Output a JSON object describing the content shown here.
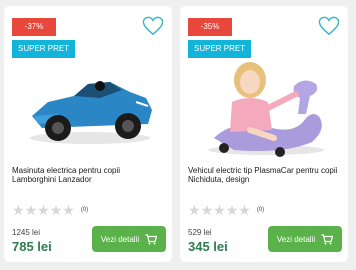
{
  "products": [
    {
      "discount": "-37%",
      "badge": "SUPER PRET",
      "title": "Masinuta electrica pentru copii Lamborghini Lanzador",
      "rating_count": "(0)",
      "old_price": "1245 lei",
      "price": "785 lei",
      "button": "Vezi detalii",
      "image": "blue-electric-car",
      "icons": [
        "heart-icon",
        "star-icon",
        "cart-icon"
      ]
    },
    {
      "discount": "-35%",
      "badge": "SUPER PRET",
      "title": "Vehicul electric tip PlasmaCar pentru copii Nichiduta, design",
      "rating_count": "(0)",
      "old_price": "529 lei",
      "price": "345 lei",
      "button": "Vezi detalii",
      "image": "girl-on-purple-plasmacar",
      "icons": [
        "heart-icon",
        "star-icon",
        "cart-icon"
      ]
    }
  ],
  "colors": {
    "discount": "#e8473c",
    "badge": "#13b4d9",
    "button": "#5bb14a",
    "price": "#2e7d4f",
    "heart": "#3fb6c9"
  }
}
